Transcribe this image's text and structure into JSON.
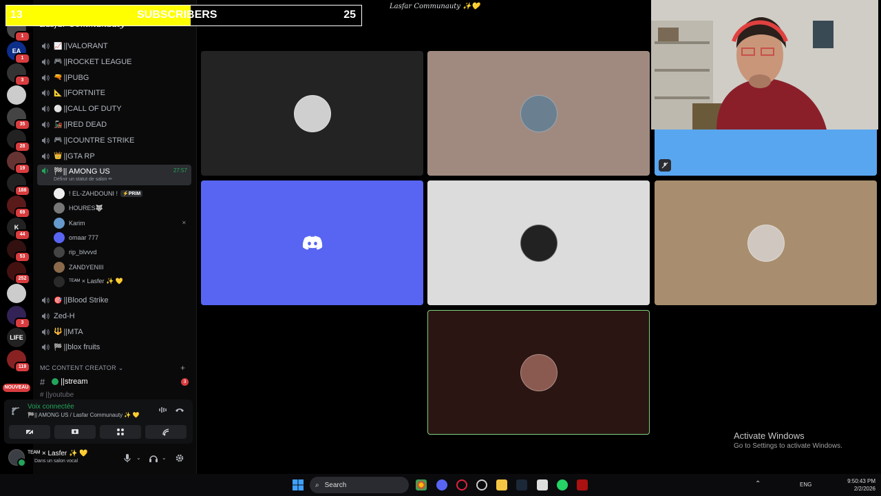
{
  "server_title": "Lasfar Communauty",
  "top_title": "Lasfar Communauty ✨💛",
  "subscriber_bar": {
    "current": "13",
    "label": "SUBSCRIBERS",
    "goal": "25",
    "progress_fraction": 0.52
  },
  "rail": {
    "servers": [
      {
        "name": "server-1",
        "badge": "1",
        "color": "#4a4a4a"
      },
      {
        "name": "server-ea",
        "badge": "1",
        "color": "#0d2e8a",
        "text": "EA"
      },
      {
        "name": "server-3",
        "badge": "3",
        "color": "#333"
      },
      {
        "name": "server-4",
        "badge": "",
        "color": "#ccc"
      },
      {
        "name": "server-5",
        "badge": "35",
        "color": "#444"
      },
      {
        "name": "server-6",
        "badge": "28",
        "color": "#222"
      },
      {
        "name": "server-7",
        "badge": "19",
        "color": "#663333"
      },
      {
        "name": "server-8",
        "badge": "188",
        "color": "#222"
      },
      {
        "name": "server-9",
        "badge": "69",
        "color": "#5a1a1a"
      },
      {
        "name": "server-10",
        "badge": "44",
        "color": "#222",
        "text": "K"
      },
      {
        "name": "server-11",
        "badge": "53",
        "color": "#331111"
      },
      {
        "name": "server-12",
        "badge": "252",
        "color": "#441111"
      },
      {
        "name": "server-13",
        "badge": "",
        "color": "#ccc"
      },
      {
        "name": "server-14",
        "badge": "3",
        "color": "#332255"
      },
      {
        "name": "server-15",
        "badge": "",
        "color": "#222",
        "text": "LIFE"
      },
      {
        "name": "server-16",
        "badge": "119",
        "color": "#882222"
      }
    ],
    "new_label": "NOUVEAU"
  },
  "channels": [
    {
      "emoji": "📈",
      "name": "||VALORANT"
    },
    {
      "emoji": "🎮",
      "name": "||ROCKET LEAGUE"
    },
    {
      "emoji": "🔫",
      "name": "||PUBG"
    },
    {
      "emoji": "📐",
      "name": "||FORTNITE"
    },
    {
      "emoji": "⚪",
      "name": "||CALL OF DUTY"
    },
    {
      "emoji": "🚂",
      "name": "||RED DEAD"
    },
    {
      "emoji": "🎮",
      "name": "||COUNTRE STRIKE"
    },
    {
      "emoji": "👑",
      "name": "||GTA RP"
    }
  ],
  "active_channel": {
    "name": "🏁|| AMONG US",
    "timer": "27:57",
    "status": "Définir un statut de salon ✏"
  },
  "members": [
    {
      "name": "! EL-ZAHDOUNI !",
      "tag": "⚡PRIM",
      "color": "#eeeeee"
    },
    {
      "name": "HOURES🐺",
      "tag": "",
      "color": "#777777"
    },
    {
      "name": "Karim",
      "tag": "",
      "color": "#6699cc",
      "muted": true
    },
    {
      "name": "omaar 777",
      "tag": "",
      "color": "#5865f2"
    },
    {
      "name": "rip_blvvvd",
      "tag": "",
      "color": "#444444"
    },
    {
      "name": "ZANDYENIII",
      "tag": "",
      "color": "#8a6a4a"
    },
    {
      "name": "ᵀᴱᴬᴹ × Lasfer ✨ 💛",
      "tag": "",
      "color": "#2a2a2a"
    }
  ],
  "channels_after": [
    {
      "emoji": "🎯",
      "name": "||Blood Strike"
    },
    {
      "emoji": "",
      "name": "Zed-H"
    },
    {
      "emoji": "🔱",
      "name": "||MTA"
    },
    {
      "emoji": "🏁",
      "name": "||blox fruits"
    }
  ],
  "category": {
    "name": "MC CONTENT CREATOR ⌄",
    "plus": "+"
  },
  "text_channels": [
    {
      "name": "||stream",
      "count": "3"
    },
    {
      "name": "||youtube"
    }
  ],
  "voice_panel": {
    "status": "Voix connectée",
    "channel": "🏁|| AMONG US / Lasfar Communauty ✨ 💛"
  },
  "user_panel": {
    "name": "ᵀᴱᴬᴹ × Lasfer ✨ 💛",
    "status": "Dans un salon vocal"
  },
  "tiles": [
    {
      "id": "tile-1",
      "bg": "#232323",
      "avatar": "#cfcfcf"
    },
    {
      "id": "tile-2",
      "bg": "#a08a80",
      "avatar": "#6a7f90"
    },
    {
      "id": "tile-3",
      "bg": "#5865f2",
      "avatar": ""
    },
    {
      "id": "tile-4",
      "bg": "#dcdcdc",
      "avatar": "#222222"
    },
    {
      "id": "tile-5",
      "bg": "#a88e6e",
      "avatar": "#d0c8c0"
    },
    {
      "id": "tile-6",
      "bg": "#2a1512",
      "avatar": "#8a5a50"
    }
  ],
  "activate_windows": {
    "title": "Activate Windows",
    "subtitle": "Go to Settings to activate Windows."
  },
  "taskbar": {
    "search": "Search",
    "lang": "ENG",
    "time": "9:50:43 PM",
    "date": "2/2/2026"
  }
}
